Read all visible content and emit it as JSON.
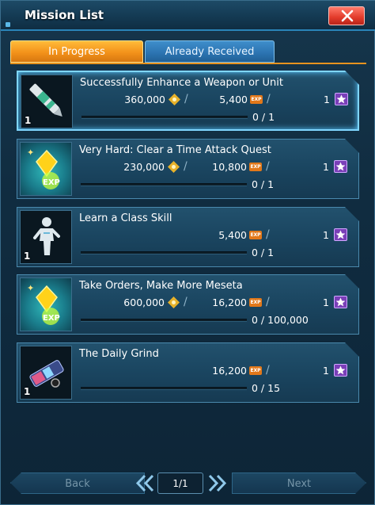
{
  "window": {
    "title": "Mission List"
  },
  "tabs": [
    {
      "label": "In Progress",
      "active": true
    },
    {
      "label": "Already Received",
      "active": false
    }
  ],
  "missions": [
    {
      "title": "Successfully Enhance a Weapon or Unit",
      "meseta": "360,000",
      "exp": "5,400",
      "star_count": "1",
      "progress": "0 / 1",
      "progress_fraction": 0,
      "thumb_count": "1",
      "thumb_icon": "pen-icon"
    },
    {
      "title": "Very Hard: Clear a Time Attack Quest",
      "meseta": "230,000",
      "exp": "10,800",
      "star_count": "1",
      "progress": "0 / 1",
      "progress_fraction": 0,
      "thumb_count": "",
      "thumb_icon": "exp-crystal-icon"
    },
    {
      "title": "Learn a Class Skill",
      "meseta": "",
      "exp": "5,400",
      "star_count": "1",
      "progress": "0 / 1",
      "progress_fraction": 0,
      "thumb_count": "1",
      "thumb_icon": "figure-icon"
    },
    {
      "title": "Take Orders, Make More Meseta",
      "meseta": "600,000",
      "exp": "16,200",
      "star_count": "1",
      "progress": "0 / 100,000",
      "progress_fraction": 0,
      "thumb_count": "",
      "thumb_icon": "exp-crystal-icon"
    },
    {
      "title": "The Daily Grind",
      "meseta": "",
      "exp": "16,200",
      "star_count": "1",
      "progress": "0 / 15",
      "progress_fraction": 0,
      "thumb_count": "1",
      "thumb_icon": "grinder-icon"
    }
  ],
  "footer": {
    "back_label": "Back",
    "page": "1/1",
    "next_label": "Next"
  },
  "icons": {
    "exp_badge": "EXP"
  },
  "colors": {
    "tab_active": "#f3921a",
    "tab_inactive": "#2b73b0",
    "close": "#e23a2a",
    "star_badge": "#7a3fb8"
  }
}
